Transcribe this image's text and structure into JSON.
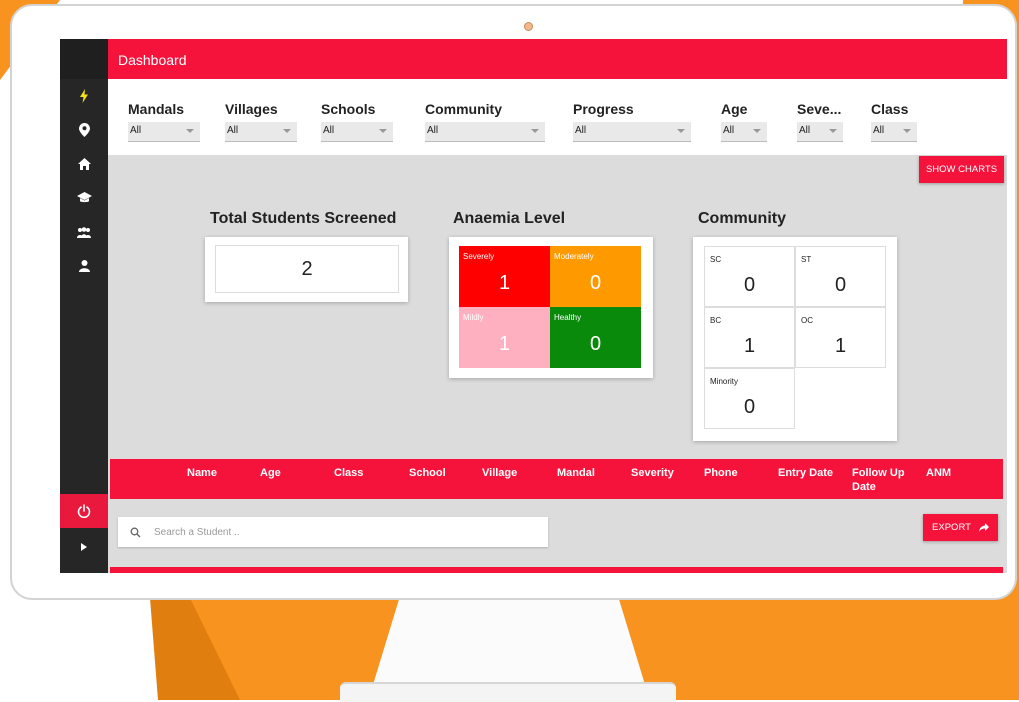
{
  "header": {
    "title": "Dashboard"
  },
  "filters": [
    {
      "label": "Mandals",
      "value": "All"
    },
    {
      "label": "Villages",
      "value": "All"
    },
    {
      "label": "Schools",
      "value": "All"
    },
    {
      "label": "Community",
      "value": "All"
    },
    {
      "label": "Progress",
      "value": "All"
    },
    {
      "label": "Age",
      "value": "All"
    },
    {
      "label": "Seve...",
      "value": "All"
    },
    {
      "label": "Class",
      "value": "All"
    }
  ],
  "buttons": {
    "show_charts": "SHOW CHARTS",
    "export": "EXPORT"
  },
  "total": {
    "title": "Total Students Screened",
    "value": "2"
  },
  "anaemia": {
    "title": "Anaemia Level",
    "tiles": [
      {
        "label": "Severely",
        "value": "1",
        "color": "#ff0000"
      },
      {
        "label": "Moderately",
        "value": "0",
        "color": "#ff9900"
      },
      {
        "label": "Mildly",
        "value": "1",
        "color": "#ffb0c0"
      },
      {
        "label": "Healthy",
        "value": "0",
        "color": "#0a8a0a"
      }
    ]
  },
  "community": {
    "title": "Community",
    "tiles": [
      {
        "label": "SC",
        "value": "0"
      },
      {
        "label": "ST",
        "value": "0"
      },
      {
        "label": "BC",
        "value": "1"
      },
      {
        "label": "OC",
        "value": "1"
      },
      {
        "label": "Minority",
        "value": "0"
      }
    ]
  },
  "table": {
    "columns": [
      "Name",
      "Age",
      "Class",
      "School",
      "Village",
      "Mandal",
      "Severity",
      "Phone",
      "Entry Date",
      "Follow Up Date",
      "ANM"
    ]
  },
  "search": {
    "placeholder": "Search a Student .."
  },
  "icons": {
    "sidebar": [
      "bolt-icon",
      "location-pin-icon",
      "home-icon",
      "graduation-cap-icon",
      "group-icon",
      "person-icon"
    ],
    "power": "power-icon",
    "expand": "chevron-right-icon",
    "search": "search-icon",
    "export": "share-arrow-icon"
  },
  "colors": {
    "accent": "#f5133c",
    "sidebar": "#262626",
    "active_icon": "#f5e11c",
    "frame": "#f7931e"
  }
}
